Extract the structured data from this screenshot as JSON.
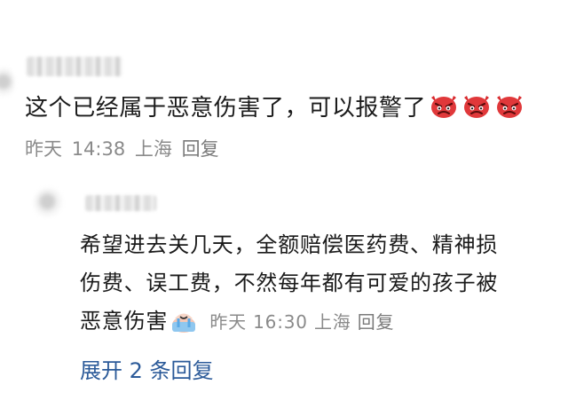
{
  "comment1": {
    "body": "这个已经属于恶意伤害了，可以报警了",
    "reaction_icons": [
      "angry-devil-icon",
      "angry-devil-icon",
      "angry-devil-icon"
    ],
    "date": "昨天",
    "time": "14:38",
    "location": "上海",
    "reply_label": "回复"
  },
  "comment2": {
    "lines": [
      "希望进去关几天，全额赔偿医药费、精神损",
      "伤费、误工费，不然每年都有可爱的孩子被",
      "恶意伤害"
    ],
    "emoji": "crying-face-icon",
    "date": "昨天",
    "time": "16:30",
    "location": "上海",
    "reply_label": "回复"
  },
  "expand_replies": "展开 2 条回复",
  "colors": {
    "link": "#2b5a99",
    "meta": "#8a8a8a",
    "text": "#1b1b1b"
  }
}
